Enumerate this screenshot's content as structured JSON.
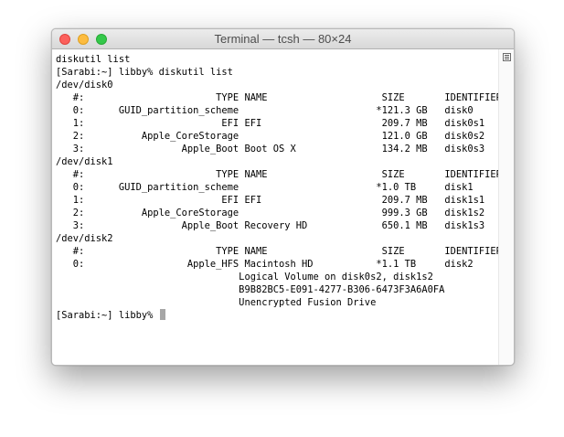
{
  "window": {
    "title": "Terminal — tcsh — 80×24"
  },
  "terminal": {
    "lines": [
      "diskutil list",
      "[Sarabi:~] libby% diskutil list",
      "/dev/disk0",
      "   #:                       TYPE NAME                    SIZE       IDENTIFIER",
      "   0:      GUID_partition_scheme                        *121.3 GB   disk0",
      "   1:                        EFI EFI                     209.7 MB   disk0s1",
      "   2:          Apple_CoreStorage                         121.0 GB   disk0s2",
      "   3:                 Apple_Boot Boot OS X               134.2 MB   disk0s3",
      "/dev/disk1",
      "   #:                       TYPE NAME                    SIZE       IDENTIFIER",
      "   0:      GUID_partition_scheme                        *1.0 TB     disk1",
      "   1:                        EFI EFI                     209.7 MB   disk1s1",
      "   2:          Apple_CoreStorage                         999.3 GB   disk1s2",
      "   3:                 Apple_Boot Recovery HD             650.1 MB   disk1s3",
      "/dev/disk2",
      "   #:                       TYPE NAME                    SIZE       IDENTIFIER",
      "   0:                  Apple_HFS Macintosh HD           *1.1 TB     disk2",
      "                                Logical Volume on disk0s2, disk1s2",
      "                                B9B82BC5-E091-4277-B306-6473F3A6A0FA",
      "                                Unencrypted Fusion Drive"
    ],
    "prompt": "[Sarabi:~] libby% "
  },
  "colors": {
    "background": "#ffffff",
    "text": "#000000",
    "cursor": "#a6a6a6",
    "close": "#fc605c",
    "minimize": "#fdbc40",
    "maximize": "#34c84a"
  },
  "icons": {
    "close": "close-button-icon",
    "minimize": "minimize-button-icon",
    "maximize": "zoom-button-icon",
    "scroll": "scroll-marker-icon"
  }
}
